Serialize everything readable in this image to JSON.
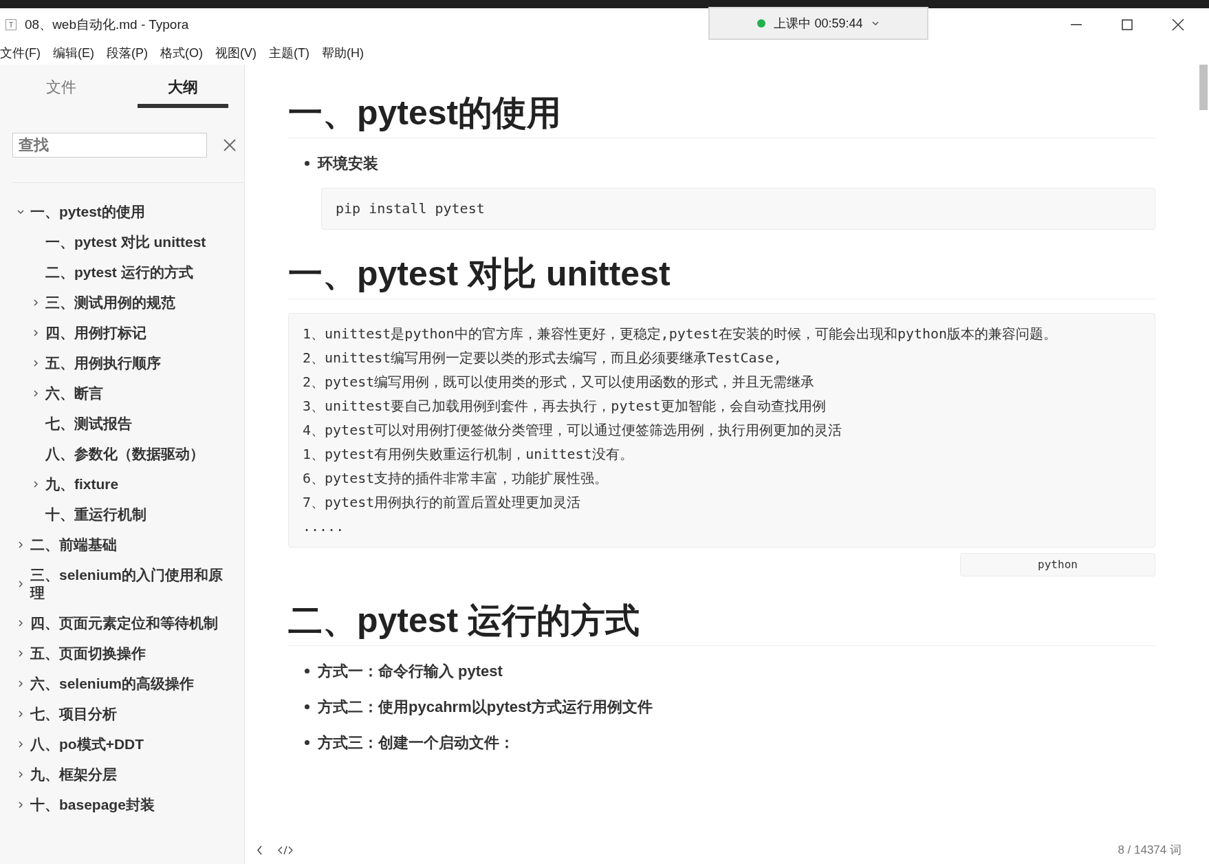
{
  "window": {
    "title": "08、web自动化.md - Typora",
    "app_icon": "T"
  },
  "recording": {
    "status": "上课中 00:59:44",
    "color": "#22b14c"
  },
  "menu": [
    "文件(F)",
    "编辑(E)",
    "段落(P)",
    "格式(O)",
    "视图(V)",
    "主题(T)",
    "帮助(H)"
  ],
  "sidebar": {
    "tabs": [
      {
        "label": "文件",
        "selected": false
      },
      {
        "label": "大纲",
        "selected": true
      }
    ],
    "search": {
      "placeholder": "查找"
    },
    "outline": [
      {
        "label": "一、pytest的使用",
        "expandable": true,
        "expanded": true,
        "children": [
          {
            "label": "一、pytest 对比 unittest",
            "expandable": false,
            "expanded": false
          },
          {
            "label": "二、pytest 运行的方式",
            "expandable": false,
            "expanded": false
          },
          {
            "label": "三、测试用例的规范",
            "expandable": true,
            "expanded": false
          },
          {
            "label": "四、用例打标记",
            "expandable": true,
            "expanded": false
          },
          {
            "label": "五、用例执行顺序",
            "expandable": true,
            "expanded": false
          },
          {
            "label": "六、断言",
            "expandable": true,
            "expanded": false
          },
          {
            "label": "七、测试报告",
            "expandable": false,
            "expanded": false
          },
          {
            "label": "八、参数化（数据驱动）",
            "expandable": false,
            "expanded": false
          },
          {
            "label": "九、fixture",
            "expandable": true,
            "expanded": false
          },
          {
            "label": "十、重运行机制",
            "expandable": false,
            "expanded": false
          }
        ]
      },
      {
        "label": "二、前端基础",
        "expandable": true,
        "expanded": false
      },
      {
        "label": "三、selenium的入门使用和原理",
        "expandable": true,
        "expanded": false
      },
      {
        "label": "四、页面元素定位和等待机制",
        "expandable": true,
        "expanded": false
      },
      {
        "label": "五、页面切换操作",
        "expandable": true,
        "expanded": false
      },
      {
        "label": "六、selenium的高级操作",
        "expandable": true,
        "expanded": false
      },
      {
        "label": "七、项目分析",
        "expandable": true,
        "expanded": false
      },
      {
        "label": "八、po模式+DDT",
        "expandable": true,
        "expanded": false
      },
      {
        "label": "九、框架分层",
        "expandable": true,
        "expanded": false
      },
      {
        "label": "十、basepage封装",
        "expandable": true,
        "expanded": false
      }
    ]
  },
  "document": [
    {
      "kind": "heading",
      "text": "一、pytest的使用"
    },
    {
      "kind": "bullet",
      "text": "环境安装"
    },
    {
      "kind": "code",
      "lines": [
        "pip install pytest"
      ]
    },
    {
      "kind": "heading",
      "text": "一、pytest 对比 unittest"
    },
    {
      "kind": "code",
      "language": "python",
      "lines": [
        "1、unittest是python中的官方库，兼容性更好，更稳定,pytest在安装的时候，可能会出现和python版本的兼容问题。",
        "2、unittest编写用例一定要以类的形式去编写，而且必须要继承TestCase,",
        "2、pytest编写用例，既可以使用类的形式，又可以使用函数的形式，并且无需继承",
        "3、unittest要自己加载用例到套件，再去执行，pytest更加智能，会自动查找用例",
        "4、pytest可以对用例打便签做分类管理，可以通过便签筛选用例，执行用例更加的灵活",
        "1、pytest有用例失败重运行机制，unittest没有。",
        "6、pytest支持的插件非常丰富，功能扩展性强。",
        "7、pytest用例执行的前置后置处理更加灵活",
        "....."
      ]
    },
    {
      "kind": "heading",
      "text": "二、pytest 运行的方式"
    },
    {
      "kind": "bullet",
      "text": "方式一：命令行输入 pytest"
    },
    {
      "kind": "bullet",
      "text": "方式二：使用pycahrm以pytest方式运行用例文件"
    },
    {
      "kind": "bullet",
      "text": "方式三：创建一个启动文件："
    }
  ],
  "status_bar": {
    "word_count": "8 / 14374 词"
  }
}
